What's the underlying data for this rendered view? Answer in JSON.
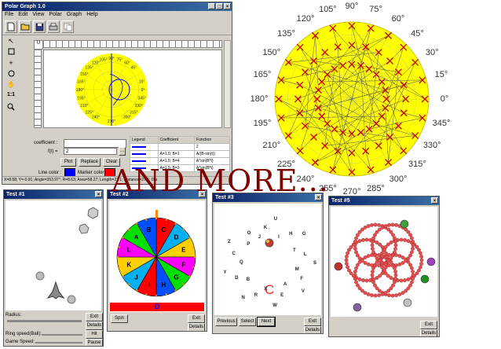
{
  "main_window": {
    "title": "Polar Graph 1.0",
    "menu": [
      "File",
      "Edit",
      "View",
      "Polar",
      "Graph",
      "Help"
    ],
    "toolbar_icons": [
      "new-icon",
      "open-icon",
      "save-icon",
      "print-icon",
      "copy-icon"
    ],
    "side_tools": [
      "pointer-icon",
      "rect-icon",
      "cross-icon",
      "circle-icon",
      "hand-icon",
      "ratio-label",
      "zoom-icon"
    ],
    "ratio_label": "1:1",
    "ruler_unit": "U",
    "small_degrees": [
      "90°",
      "105°",
      "75°",
      "120°",
      "60°",
      "135°",
      "45°",
      "150°",
      "165°",
      "15°",
      "180°",
      "0°",
      "195°",
      "345°",
      "210°",
      "330°",
      "225°",
      "315°",
      "240°",
      "270°",
      "300°"
    ],
    "coefficient_label": "coefficient :",
    "f_label": "f(t) =",
    "f_value": "2",
    "buttons": {
      "plot": "Plot",
      "replace": "Replace",
      "clear": "Clear",
      "ellipsis": "..."
    },
    "line_color_label": "Line color :",
    "marker_color_label": "Marker color :",
    "line_color": "#0000ff",
    "marker_color": "#ff0000",
    "table": {
      "headers": [
        "Legend",
        "Coefficient",
        "Function"
      ],
      "rows": [
        [
          "",
          "",
          "2"
        ],
        [
          "",
          "A=1.5; B=1",
          "A/(B-sin(t))"
        ],
        [
          "",
          "A=1.5; B=4",
          "A*sin(B*t)"
        ],
        [
          "",
          "A=1.5; B=3",
          "A*sin(B*t)"
        ]
      ]
    },
    "status": "X=8.58; Y=-0.91; Angle=353.97°; R=8.63; Area=58.27; Length=27.1; Distance=27.1; Dia"
  },
  "polar_chart": {
    "labels": [
      {
        "text": "90°"
      },
      {
        "text": "105°"
      },
      {
        "text": "75°"
      },
      {
        "text": "120°"
      },
      {
        "text": "60°"
      },
      {
        "text": "135°"
      },
      {
        "text": "45°"
      },
      {
        "text": "150°"
      },
      {
        "text": "30°"
      },
      {
        "text": "165°"
      },
      {
        "text": "15°"
      },
      {
        "text": "180°"
      },
      {
        "text": "0°"
      },
      {
        "text": "195°"
      },
      {
        "text": "345°"
      },
      {
        "text": "210°"
      },
      {
        "text": "330°"
      },
      {
        "text": "225°"
      },
      {
        "text": "315°"
      },
      {
        "text": "240°"
      },
      {
        "text": "300°"
      },
      {
        "text": "255°"
      },
      {
        "text": "285°"
      },
      {
        "text": "270°"
      }
    ],
    "fill": "#ffff00",
    "marker_color": "#cc0000"
  },
  "overlay_text": "AND MORE...",
  "test1": {
    "title": "Test #1",
    "radius_label": "Radius:",
    "ring_speed_label": "Ring speed(Ball):",
    "game_speed_label": "Game Speed:",
    "buttons": [
      "Exit",
      "Details",
      "Hit Area",
      "Pause"
    ]
  },
  "test2": {
    "title": "Test #2",
    "wheel_letters": [
      "A",
      "B",
      "C",
      "D",
      "E",
      "F",
      "G",
      "H",
      "I",
      "J",
      "K",
      "L"
    ],
    "result": "D",
    "buttons": {
      "spin": "Spin",
      "exit": "Exit",
      "details": "Details"
    }
  },
  "test3": {
    "title": "Test #3",
    "grid_letters": [
      "J",
      "K",
      "U",
      "I",
      "H",
      "G",
      "T",
      "L",
      "S",
      "M",
      "F",
      "V",
      "A",
      "E",
      "W",
      "X",
      "R",
      "N",
      "B",
      "D",
      "Y",
      "Q",
      "C",
      "Z",
      "P",
      "O"
    ],
    "center_letter": "C",
    "buttons": {
      "previous": "Previous",
      "select": "Select",
      "next": "Next",
      "exit": "Exit",
      "details": "Details"
    }
  },
  "test5": {
    "title": "Test #5",
    "buttons": {
      "exit": "Exit",
      "details": "Details"
    }
  }
}
